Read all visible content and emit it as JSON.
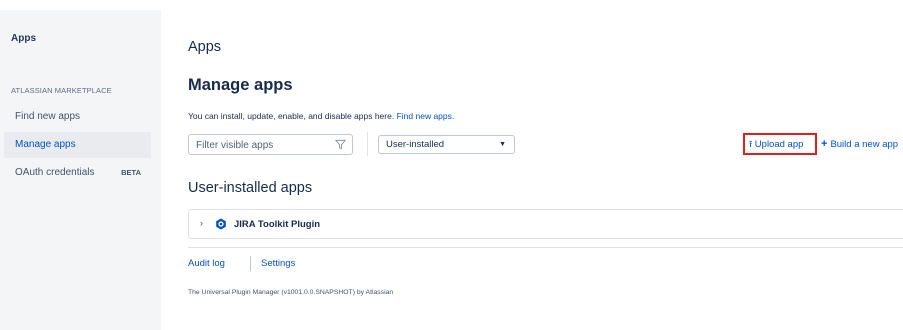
{
  "sidebar": {
    "title": "Apps",
    "section_label": "ATLASSIAN MARKETPLACE",
    "items": [
      {
        "label": "Find new apps"
      },
      {
        "label": "Manage apps"
      },
      {
        "label": "OAuth credentials",
        "badge": "BETA"
      }
    ]
  },
  "main": {
    "heading": "Apps",
    "subheading": "Manage apps",
    "description": "You can install, update, enable, and disable apps here.",
    "description_link": "Find new apps.",
    "filter": {
      "placeholder": "Filter visible apps",
      "value": "",
      "icon": "filter-icon"
    },
    "select": {
      "selected": "User-installed"
    },
    "actions": {
      "upload_label": "Upload app",
      "upload_icon": "upload-arrow-icon",
      "build_label": "Build a new app",
      "build_icon": "plus-icon"
    },
    "user_installed_heading": "User-installed apps",
    "plugins": [
      {
        "name": "JIRA Toolkit Plugin",
        "icon": "plugin-gear-icon"
      }
    ],
    "links": {
      "audit_log": "Audit log",
      "settings": "Settings"
    },
    "footer": "The Universal Plugin Manager (v1001.0.0.SNAPSHOT) by Atlassian"
  },
  "colors": {
    "link": "#0052cc",
    "highlight": "#e02020",
    "sidebar_bg": "#f4f5f7",
    "active_item": "#0052cc"
  }
}
